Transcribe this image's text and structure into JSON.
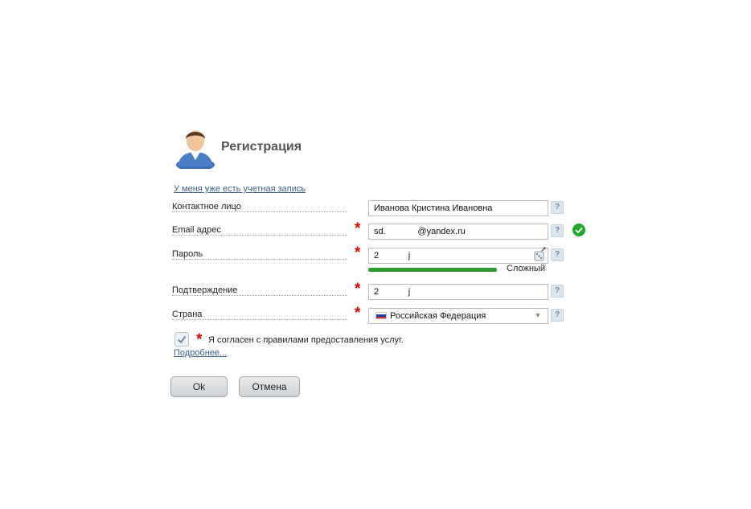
{
  "header": {
    "title": "Регистрация",
    "avatar_icon": "user-avatar-icon"
  },
  "links": {
    "have_account": "У меня уже есть учетная запись",
    "more": "Подробнее..."
  },
  "form": {
    "contact": {
      "label": "Контактное лицо",
      "value": "Иванова Кристина Ивановна",
      "help": "?"
    },
    "email": {
      "label": "Email адрес",
      "value": "sd.             @yandex.ru",
      "help": "?",
      "required": "*",
      "status_icon": "check-circle-icon",
      "status_color": "#1fa82a"
    },
    "password": {
      "label": "Пароль",
      "value": "2            j",
      "help": "?",
      "required": "*",
      "strength_label": "Сложный",
      "strength_color": "#2d9e2d"
    },
    "confirm": {
      "label": "Подтверждение",
      "value": "2            j",
      "help": "?",
      "required": "*"
    },
    "country": {
      "label": "Страна",
      "value": "Российская Федерация",
      "help": "?",
      "required": "*",
      "flag_icon": "russia-flag-icon"
    }
  },
  "agreement": {
    "required": "*",
    "text": "Я согласен с правилами предоставления услуг.",
    "checked": true
  },
  "buttons": {
    "ok": "Ok",
    "cancel": "Отмена"
  }
}
